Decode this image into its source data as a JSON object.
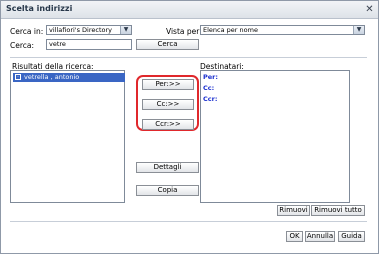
{
  "window": {
    "title": "Scelta indirizzi"
  },
  "search": {
    "in_label": "Cerca in:",
    "in_value": "villafiori's Directory",
    "view_label": "Vista per:",
    "view_value": "Elenca per nome",
    "search_label": "Cerca:",
    "search_value": "vetre",
    "search_button": "Cerca"
  },
  "results": {
    "label": "Risultati della ricerca:",
    "items": [
      "vetrella , antonio"
    ]
  },
  "recipients": {
    "label": "Destinatari:",
    "fields": [
      "Per:",
      "Cc:",
      "Ccr:"
    ]
  },
  "buttons": {
    "to": "Per:>>",
    "cc": "Cc:>>",
    "bcc": "Ccr:>>",
    "details": "Dettagli",
    "copy": "Copia",
    "remove": "Rimuovi",
    "remove_all": "Rimuovi tutto",
    "ok": "OK",
    "cancel": "Annulla",
    "help": "Guida"
  },
  "colors": {
    "highlight": "#e0282c",
    "selection": "#3a66c4",
    "recipient_labels": "#1a2fcf"
  }
}
